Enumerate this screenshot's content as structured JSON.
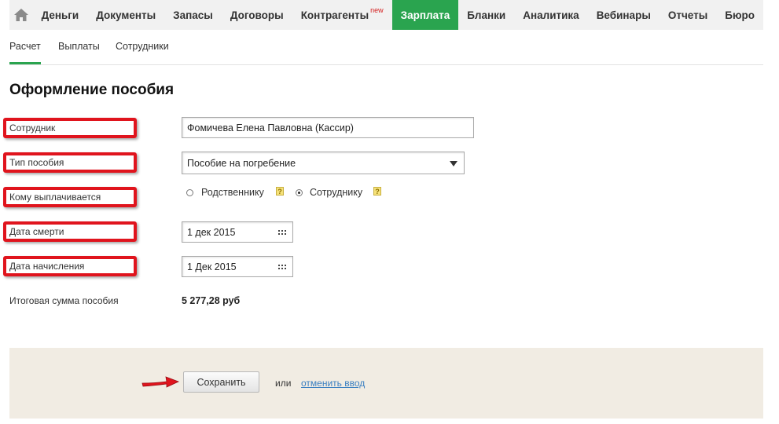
{
  "topnav": {
    "home_icon": "home-icon",
    "items": [
      {
        "label": "Деньги"
      },
      {
        "label": "Документы"
      },
      {
        "label": "Запасы"
      },
      {
        "label": "Договоры"
      },
      {
        "label": "Контрагенты",
        "badge": "new"
      },
      {
        "label": "Зарплата",
        "active": true
      },
      {
        "label": "Бланки"
      },
      {
        "label": "Аналитика"
      },
      {
        "label": "Вебинары"
      },
      {
        "label": "Отчеты"
      },
      {
        "label": "Бюро"
      }
    ],
    "active_color": "#2aa44f"
  },
  "subnav": {
    "tabs": [
      {
        "label": "Расчет",
        "active": true
      },
      {
        "label": "Выплаты"
      },
      {
        "label": "Сотрудники"
      }
    ]
  },
  "page": {
    "title": "Оформление пособия"
  },
  "form": {
    "employee": {
      "label": "Сотрудник",
      "value": "Фомичева Елена Павловна (Кассир)"
    },
    "benefit_type": {
      "label": "Тип пособия",
      "value": "Пособие на погребение"
    },
    "paid_to": {
      "label": "Кому выплачивается",
      "options": [
        {
          "label": "Родственнику",
          "checked": false
        },
        {
          "label": "Сотруднику",
          "checked": true
        }
      ],
      "help_symbol": "?"
    },
    "death_date": {
      "label": "Дата смерти",
      "value": "1 дек 2015"
    },
    "accrual_date": {
      "label": "Дата начисления",
      "value": "1 Дек 2015"
    },
    "total": {
      "label": "Итоговая сумма пособия",
      "value": "5 277,28 руб"
    }
  },
  "footer": {
    "save_label": "Сохранить",
    "or_text": "или",
    "cancel_label": "отменить ввод",
    "highlight_color": "#e0141d"
  }
}
